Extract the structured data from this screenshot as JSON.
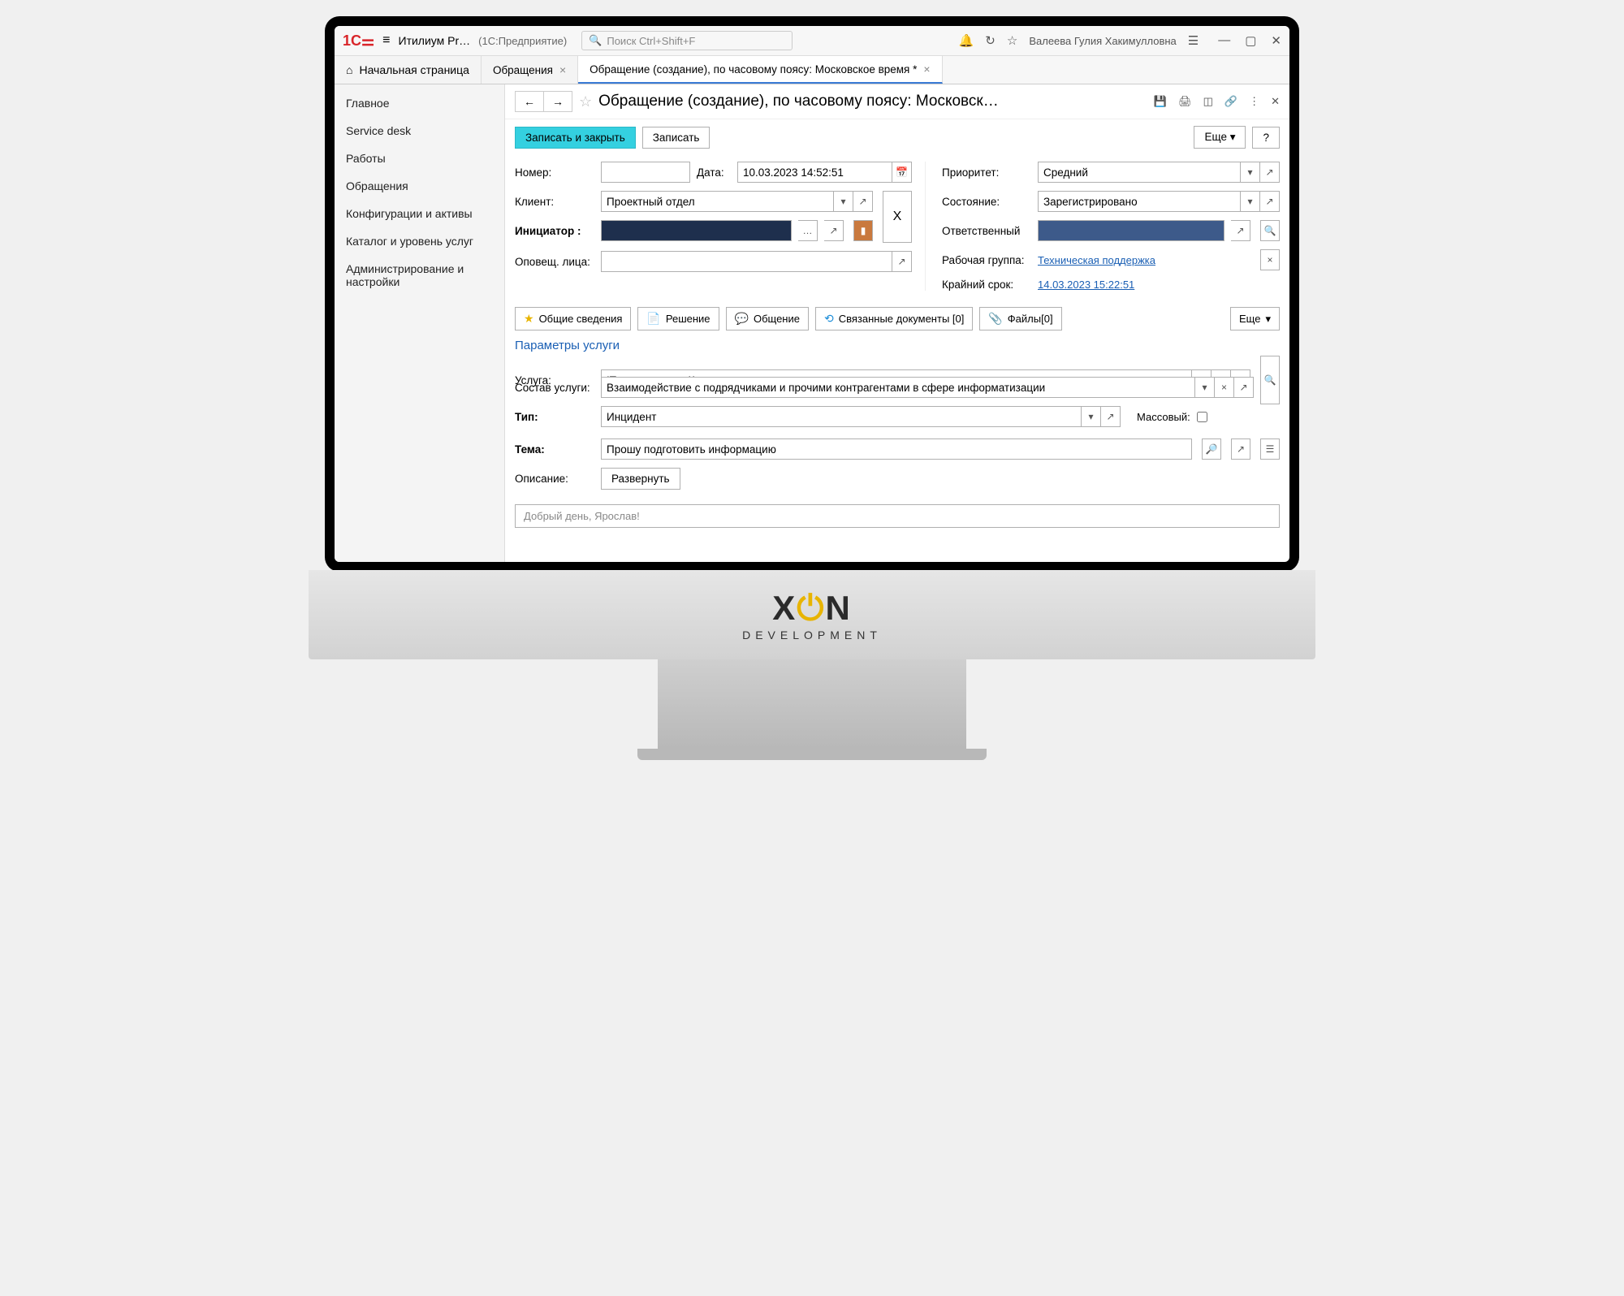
{
  "titlebar": {
    "app_title": "Итилиум Pr…",
    "app_sub": "(1С:Предприятие)",
    "search_placeholder": "Поиск Ctrl+Shift+F",
    "user_name": "Валеева Гулия Хакимулловна"
  },
  "tabs": {
    "home": "Начальная страница",
    "items": [
      {
        "label": "Обращения"
      },
      {
        "label": "Обращение (создание),  по часовому поясу: Московское время *",
        "active": true
      }
    ]
  },
  "sidebar": {
    "items": [
      "Главное",
      "Service desk",
      "Работы",
      "Обращения",
      "Конфигурации и активы",
      "Каталог и уровень услуг",
      "Администрирование и настройки"
    ]
  },
  "page": {
    "title": "Обращение (создание),  по часовому поясу: Московск…"
  },
  "actions": {
    "save_close": "Записать и закрыть",
    "save": "Записать",
    "more": "Еще",
    "help": "?"
  },
  "form": {
    "number_label": "Номер:",
    "number_value": "",
    "date_label": "Дата:",
    "date_value": "10.03.2023 14:52:51",
    "client_label": "Клиент:",
    "client_value": "Проектный отдел",
    "initiator_label": "Инициатор :",
    "notify_label": "Оповещ. лица:",
    "priority_label": "Приоритет:",
    "priority_value": "Средний",
    "state_label": "Состояние:",
    "state_value": "Зарегистрировано",
    "responsible_label": "Ответственный",
    "workgroup_label": "Рабочая группа:",
    "workgroup_value": "Техническая поддержка",
    "deadline_label": "Крайний срок:",
    "deadline_value": "14.03.2023 15:22:51"
  },
  "subtabs": {
    "general": "Общие сведения",
    "solution": "Решение",
    "chat": "Общение",
    "related": "Связанные документы [0]",
    "files": "Файлы[0]",
    "more": "Еще"
  },
  "service": {
    "section_title": "Параметры услуги",
    "service_label": "Услуга:",
    "service_value": "IT-менеджмент. Комплексная услуга",
    "component_label": "Состав услуги:",
    "component_value": "Взаимодействие с подрядчиками и прочими контрагентами в сфере информатизации",
    "type_label": "Тип:",
    "type_value": "Инцидент",
    "mass_label": "Массовый:",
    "topic_label": "Тема:",
    "topic_value": "Прошу подготовить информацию",
    "desc_label": "Описание:",
    "expand": "Развернуть",
    "desc_preview": "Добрый день,   Ярослав!"
  },
  "branding": {
    "name": "XON",
    "sub": "DEVELOPMENT"
  }
}
